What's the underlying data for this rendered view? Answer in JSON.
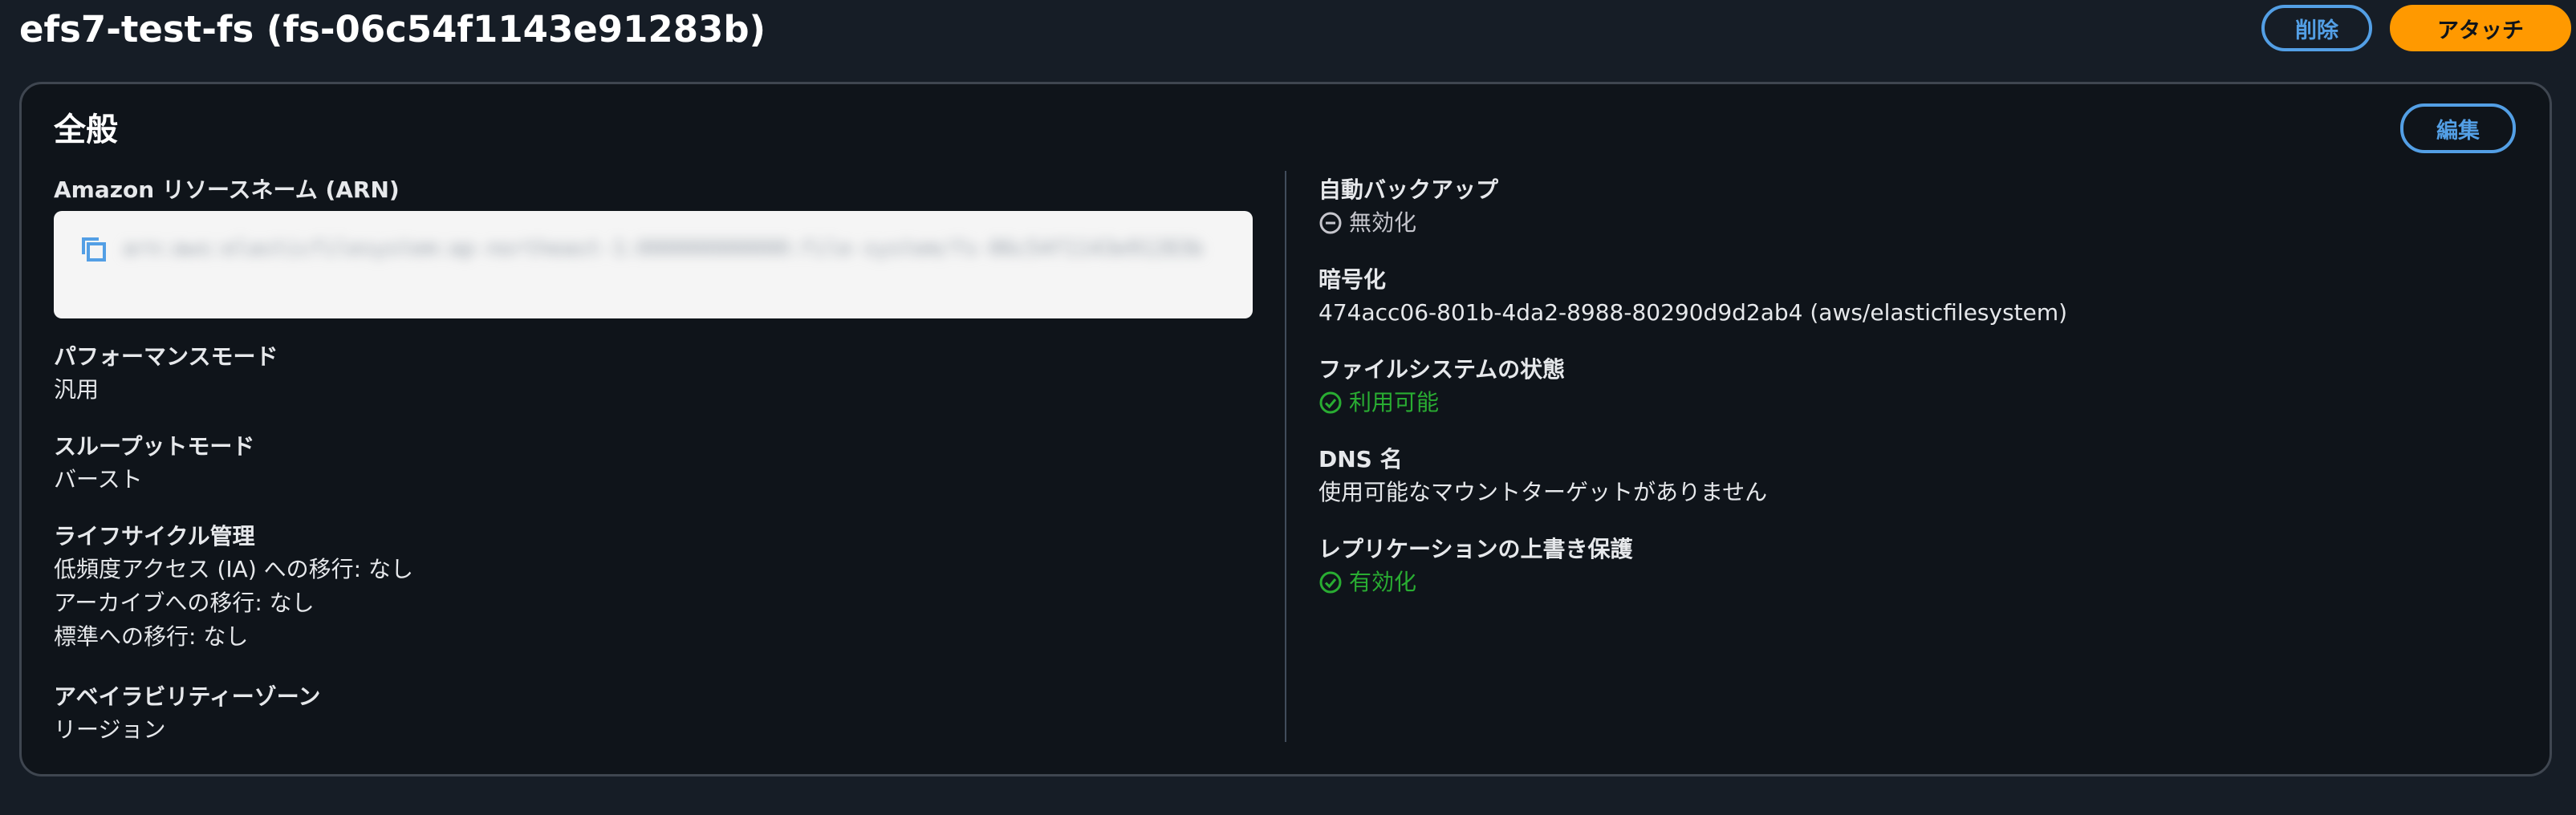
{
  "header": {
    "title": "efs7-test-fs (fs-06c54f1143e91283b)",
    "delete_label": "削除",
    "attach_label": "アタッチ"
  },
  "panel": {
    "title": "全般",
    "edit_label": "編集"
  },
  "left_column": {
    "arn": {
      "label": "Amazon リソースネーム (ARN)",
      "value": "arn:aws:elasticfilesystem:ap-northeast-1:000000000000:file-system/fs-06c54f1143e91283b"
    },
    "performance_mode": {
      "label": "パフォーマンスモード",
      "value": "汎用"
    },
    "throughput_mode": {
      "label": "スループットモード",
      "value": "バースト"
    },
    "lifecycle": {
      "label": "ライフサイクル管理",
      "lines": [
        "低頻度アクセス (IA) への移行: なし",
        "アーカイブへの移行: なし",
        "標準への移行: なし"
      ]
    },
    "availability_zone": {
      "label": "アベイラビリティーゾーン",
      "value": "リージョン"
    }
  },
  "right_column": {
    "auto_backup": {
      "label": "自動バックアップ",
      "value": "無効化",
      "icon": "disabled-circle-icon"
    },
    "encryption": {
      "label": "暗号化",
      "value": "474acc06-801b-4da2-8988-80290d9d2ab4 (aws/elasticfilesystem)"
    },
    "fs_state": {
      "label": "ファイルシステムの状態",
      "value": "利用可能",
      "icon": "check-circle-icon"
    },
    "dns_name": {
      "label": "DNS 名",
      "value": "使用可能なマウントターゲットがありません"
    },
    "replication": {
      "label": "レプリケーションの上書き保護",
      "value": "有効化",
      "icon": "check-circle-icon"
    }
  },
  "colors": {
    "background": "#161d26",
    "panel": "#0f141a",
    "accent_blue": "#539fe5",
    "primary_orange": "#ff9900",
    "success_green": "#29ad32"
  }
}
